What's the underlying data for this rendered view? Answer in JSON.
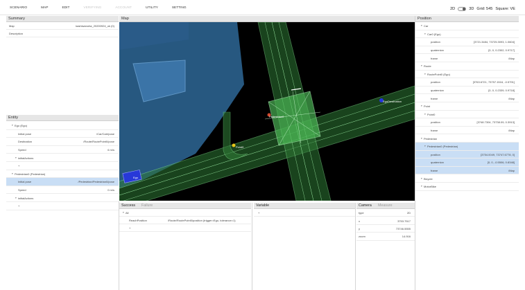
{
  "menu": [
    "SCENARIO",
    "MAP",
    "EDIT",
    "VERIFYING",
    "ACCOUNT",
    "UTILITY",
    "SETTING"
  ],
  "menu_disabled": [
    "VERIFYING",
    "ACCOUNT"
  ],
  "view": {
    "mode_2d": "2D",
    "mode_3d": "3D",
    "grid": "Grid: 545",
    "square": "Square: VE"
  },
  "summary": {
    "title": "Summary",
    "rows": [
      {
        "key": "Map",
        "value": "kashiwanoha_20200924_ok (0)"
      },
      {
        "key": "Description",
        "value": ""
      }
    ]
  },
  "entity": {
    "title": "Entity",
    "rows": [
      {
        "key": "Ego (Ego)",
        "value": "",
        "level": 0
      },
      {
        "key": "Initial pose",
        "value": "/Car/Cart/pose",
        "level": 1
      },
      {
        "key": "Destination",
        "value": "/Route/RoutePoint0/pose",
        "level": 1
      },
      {
        "key": "Speed",
        "value": "6 m/s",
        "level": 1
      },
      {
        "key": "initialActions",
        "value": "",
        "level": 1
      },
      {
        "key": "+",
        "value": "",
        "level": 1
      },
      {
        "key": "Pedestrian0 (Pedestrian)",
        "value": "",
        "level": 0
      },
      {
        "key": "Initial pose",
        "value": "/Pedestrian/Pedestrian0/pose",
        "level": 1,
        "selected": true
      },
      {
        "key": "Speed",
        "value": "0 m/s",
        "level": 1
      },
      {
        "key": "initialActions",
        "value": "",
        "level": 1
      },
      {
        "key": "+",
        "value": "",
        "level": 1
      }
    ]
  },
  "map_panel": {
    "title": "Map",
    "labels": {
      "pedestrian": "Pedestrian0",
      "point": "Point0",
      "destination": "EgoDestination",
      "ego": "Ego"
    }
  },
  "position": {
    "title": "Position",
    "rows": [
      {
        "key": "Car",
        "value": "",
        "level": 0
      },
      {
        "key": "Car0 (Ego)",
        "value": "",
        "level": 1
      },
      {
        "key": "position",
        "value": "[3721.3484, 73725.3093, 1.0604]",
        "level": 2
      },
      {
        "key": "quaternion",
        "value": "[0, 0, 0.2302, 0.9717]",
        "level": 2
      },
      {
        "key": "frame",
        "value": "/Map",
        "level": 2
      },
      {
        "key": "Route",
        "value": "",
        "level": 0
      },
      {
        "key": "RoutePoint0 (Ego)",
        "value": "",
        "level": 1
      },
      {
        "key": "position",
        "value": "[3763.6721, 73757.1516, -0.5791]",
        "level": 2
      },
      {
        "key": "quaternion",
        "value": "[0, 0, 0.2339, 0.9718]",
        "level": 2
      },
      {
        "key": "frame",
        "value": "/Map",
        "level": 2
      },
      {
        "key": "Point",
        "value": "",
        "level": 0
      },
      {
        "key": "Point0",
        "value": "",
        "level": 1
      },
      {
        "key": "position",
        "value": "[3748.7304, 73738.09, 0.3913]",
        "level": 2
      },
      {
        "key": "frame",
        "value": "/Map",
        "level": 2
      },
      {
        "key": "Pedestrian",
        "value": "",
        "level": 0
      },
      {
        "key": "Pedestrian0 (Pedestrian)",
        "value": "",
        "level": 1,
        "selected": true
      },
      {
        "key": "position",
        "value": "[3754.0049, 73747.6778, 0]",
        "level": 2,
        "selected": true
      },
      {
        "key": "quaternion",
        "value": "[0, 0, -0.5506, 0.8348]",
        "level": 2,
        "selected": true
      },
      {
        "key": "frame",
        "value": "/Map",
        "level": 2,
        "selected": true
      },
      {
        "key": "Bicycle",
        "value": "",
        "level": 0
      },
      {
        "key": "MotorBike",
        "value": "",
        "level": 0
      }
    ]
  },
  "success": {
    "tabs": [
      "Success",
      "Failure"
    ],
    "rows": [
      {
        "key": "All",
        "value": "",
        "level": 0
      },
      {
        "key": "ReachPosition",
        "value": "/Route/RoutePoint0/position (trigger=Ego, tolerance=1)",
        "level": 1
      },
      {
        "key": "+",
        "value": "",
        "level": 1
      }
    ]
  },
  "variable": {
    "title": "Variable",
    "rows": [
      {
        "key": "+",
        "value": ""
      }
    ]
  },
  "camera": {
    "tabs": [
      "Camera",
      "Measure"
    ],
    "rows": [
      {
        "key": "type",
        "value": "2D"
      },
      {
        "key": "x",
        "value": "3753.7517"
      },
      {
        "key": "y",
        "value": "73746.5555"
      },
      {
        "key": "zoom",
        "value": "14.916"
      }
    ]
  },
  "colors": {
    "selection": "#c9def5",
    "road": "#5fd36a",
    "building": "#2e5f8a",
    "map_bg": "#000000"
  }
}
